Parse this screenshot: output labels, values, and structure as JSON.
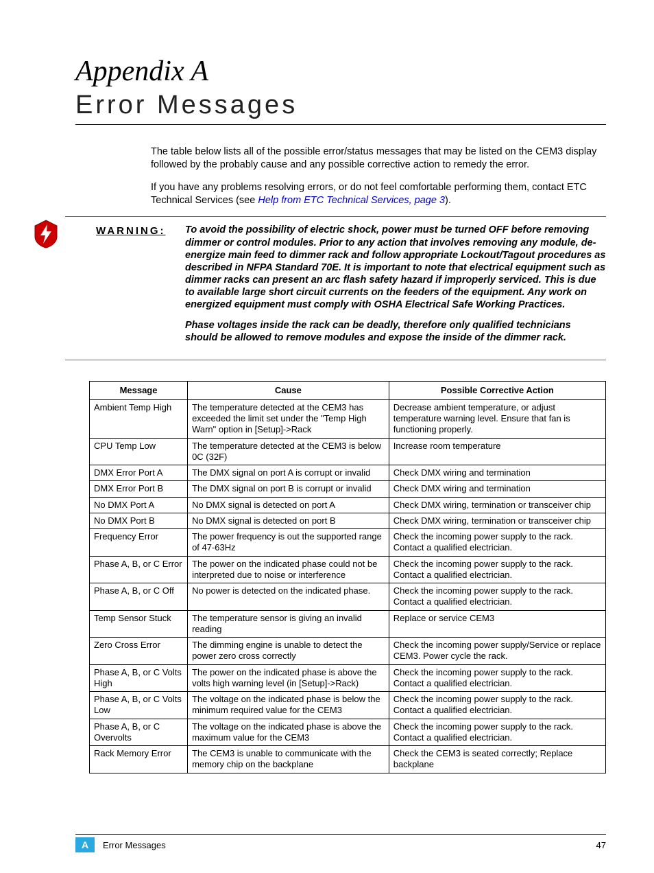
{
  "header": {
    "appendix": "Appendix A",
    "section": "Error Messages"
  },
  "intro": {
    "p1": "The table below lists all of the possible error/status messages that may be listed on the CEM3 display followed by the probably cause and any possible corrective action to remedy the error.",
    "p2_a": "If you have any problems resolving errors, or do not feel comfortable performing them, contact ETC Technical Services (see ",
    "p2_link": "Help from ETC Technical Services, page 3",
    "p2_b": ")."
  },
  "warning": {
    "label": "WARNING:",
    "p1": "To avoid the possibility of electric shock, power must be turned OFF before removing dimmer or control modules. Prior to any action that involves removing any module, de-energize main feed to dimmer rack and follow appropriate Lockout/Tagout procedures as described in NFPA Standard 70E. It is important to note that electrical equipment such as dimmer racks can present an arc flash safety hazard if improperly serviced. This is due to available large short circuit currents on the feeders of the equipment. Any work on energized equipment must comply with OSHA Electrical Safe Working Practices.",
    "p2": "Phase voltages inside the rack can be deadly, therefore only qualified technicians should be allowed to remove modules and expose the inside of the dimmer rack."
  },
  "table": {
    "headers": {
      "c1": "Message",
      "c2": "Cause",
      "c3": "Possible Corrective Action"
    },
    "rows": [
      {
        "c1": "Ambient Temp High",
        "c2": "The temperature detected at the CEM3 has exceeded the limit set under the \"Temp High Warn\" option in [Setup]->Rack",
        "c3": "Decrease ambient temperature, or adjust temperature warning level. Ensure that fan is functioning properly."
      },
      {
        "c1": "CPU Temp Low",
        "c2": "The temperature detected at the CEM3 is below 0C (32F)",
        "c3": "Increase room temperature"
      },
      {
        "c1": "DMX Error Port A",
        "c2": "The DMX signal on port A is corrupt or invalid",
        "c3": "Check DMX wiring and termination"
      },
      {
        "c1": "DMX Error Port B",
        "c2": "The DMX signal on port B is corrupt or invalid",
        "c3": "Check DMX wiring and termination"
      },
      {
        "c1": "No DMX Port A",
        "c2": "No DMX signal is detected on port A",
        "c3": "Check DMX wiring, termination or transceiver chip"
      },
      {
        "c1": "No DMX Port B",
        "c2": "No DMX signal is detected on port B",
        "c3": "Check DMX wiring, termination or transceiver chip"
      },
      {
        "c1": "Frequency Error",
        "c2": "The power frequency is out the supported range of 47-63Hz",
        "c3": "Check the incoming power supply to the rack. Contact a qualified electrician."
      },
      {
        "c1": "Phase A, B, or C Error",
        "c2": "The power on the indicated phase could not be interpreted due to noise or interference",
        "c3": "Check the incoming power supply to the rack. Contact a qualified electrician."
      },
      {
        "c1": "Phase A, B, or C Off",
        "c2": "No power is detected on the indicated phase.",
        "c3": "Check the incoming power supply to the rack. Contact a qualified electrician."
      },
      {
        "c1": "Temp Sensor Stuck",
        "c2": "The temperature sensor is giving an invalid reading",
        "c3": "Replace or service CEM3"
      },
      {
        "c1": "Zero Cross Error",
        "c2": "The dimming engine is unable to detect the power zero cross correctly",
        "c3": "Check the incoming power supply/Service or replace CEM3. Power cycle the rack."
      },
      {
        "c1": "Phase A, B, or C Volts High",
        "c2": "The power on the indicated phase is above the volts high warning level (in [Setup]->Rack)",
        "c3": "Check the incoming power supply to the rack. Contact a qualified electrician."
      },
      {
        "c1": "Phase A, B, or C Volts Low",
        "c2": "The voltage on the indicated phase is below the minimum required value for the CEM3",
        "c3": "Check the incoming power supply to the rack. Contact a qualified electrician."
      },
      {
        "c1": "Phase A, B, or C Overvolts",
        "c2": "The voltage on the indicated phase is above the maximum value for the CEM3",
        "c3": "Check the incoming power supply to the rack. Contact a qualified electrician."
      },
      {
        "c1": "Rack Memory Error",
        "c2": "The CEM3 is unable to communicate with the memory chip on the backplane",
        "c3": "Check the CEM3 is seated correctly; Replace backplane"
      }
    ]
  },
  "footer": {
    "badge": "A",
    "crumb": "Error Messages",
    "page": "47"
  }
}
